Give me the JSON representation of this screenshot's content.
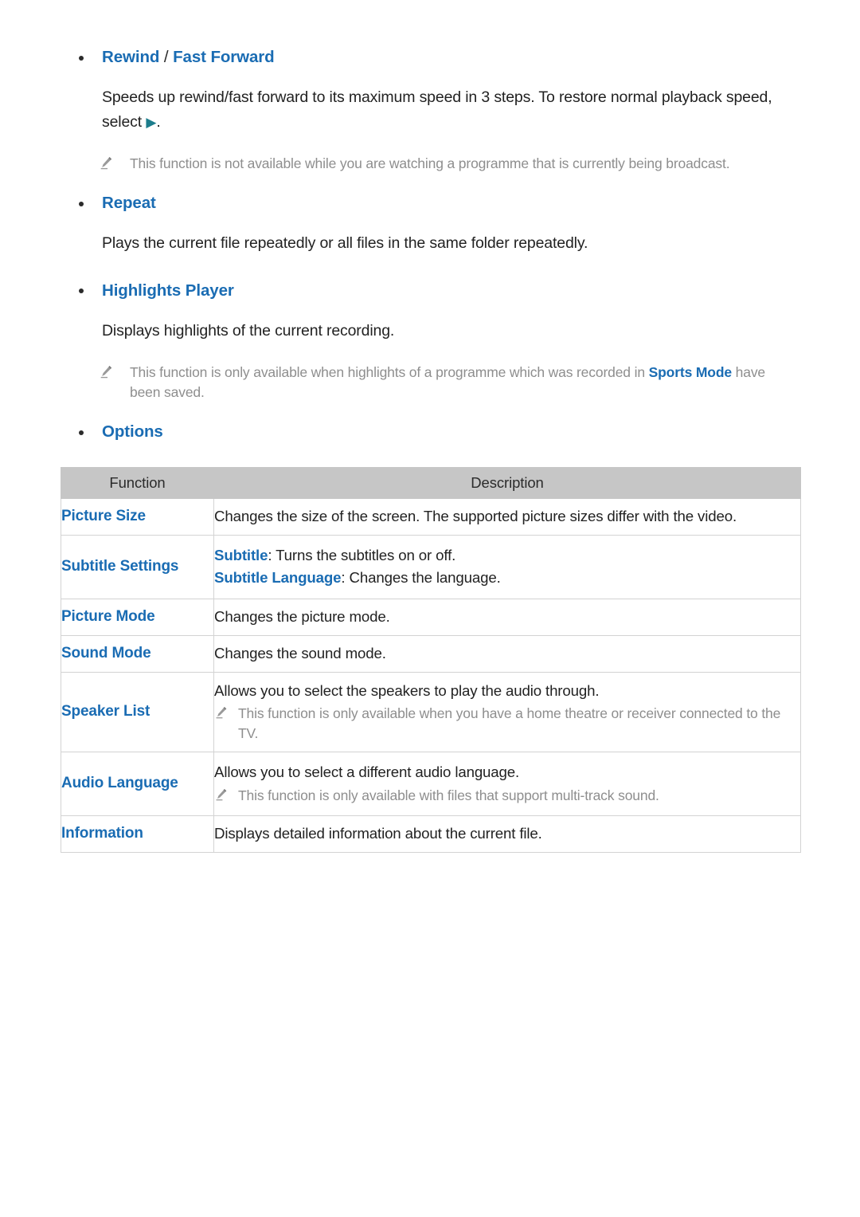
{
  "document": {
    "sections": [
      {
        "id": "rewind-fast-forward",
        "bullet_title_part1": "Rewind",
        "bullet_title_sep": " / ",
        "bullet_title_part2": "Fast Forward",
        "body": "Speeds up rewind/fast forward to its maximum speed in 3 steps. To restore normal playback speed, select",
        "body_glyph": "▶",
        "body_tail": ".",
        "note": "This function is not available while you are watching a programme that is currently being broadcast."
      },
      {
        "id": "repeat",
        "bullet_title_part1": "Repeat",
        "body": "Plays the current file repeatedly or all files in the same folder repeatedly."
      },
      {
        "id": "highlights-player",
        "bullet_title_part1": "Highlights Player",
        "body": "Displays highlights of the current recording.",
        "note_pre": "This function is only available when highlights of a programme which was recorded in ",
        "note_highlight": "Sports Mode",
        "note_post": " have been saved."
      },
      {
        "id": "options",
        "bullet_title_part1": "Options"
      }
    ]
  },
  "options_table": {
    "headers": [
      "Function",
      "Description"
    ],
    "rows": [
      {
        "function": "Picture Size",
        "description": "Changes the size of the screen. The supported picture sizes differ with the video.",
        "lines": [],
        "note": null
      },
      {
        "function": "Subtitle Settings",
        "description": null,
        "lines": [
          {
            "highlight": "Subtitle",
            "text": ": Turns the subtitles on or off."
          },
          {
            "highlight": "Subtitle Language",
            "text": ": Changes the language."
          }
        ],
        "note": null
      },
      {
        "function": "Picture Mode",
        "description": "Changes the picture mode.",
        "lines": [],
        "note": null
      },
      {
        "function": "Sound Mode",
        "description": "Changes the sound mode.",
        "lines": [],
        "note": null
      },
      {
        "function": "Speaker List",
        "description": "Allows you to select the speakers to play the audio through.",
        "lines": [],
        "note": "This function is only available when you have a home theatre or receiver connected to the TV."
      },
      {
        "function": "Audio Language",
        "description": "Allows you to select a different audio language.",
        "lines": [],
        "note": "This function is only available with files that support multi-track sound."
      },
      {
        "function": "Information",
        "description": "Displays detailed information about the current file.",
        "lines": [],
        "note": null
      }
    ]
  },
  "colors": {
    "link_blue": "#1a6cb3",
    "note_gray": "#8e8e8e",
    "header_gray": "#c6c6c6",
    "body_text": "#222222",
    "play_teal": "#1d7d8c",
    "border": "#d3d3d3"
  },
  "icons": {
    "pencil": "pencil-note-icon",
    "bullet": "bullet-dot-icon",
    "play": "play-triangle-icon"
  }
}
